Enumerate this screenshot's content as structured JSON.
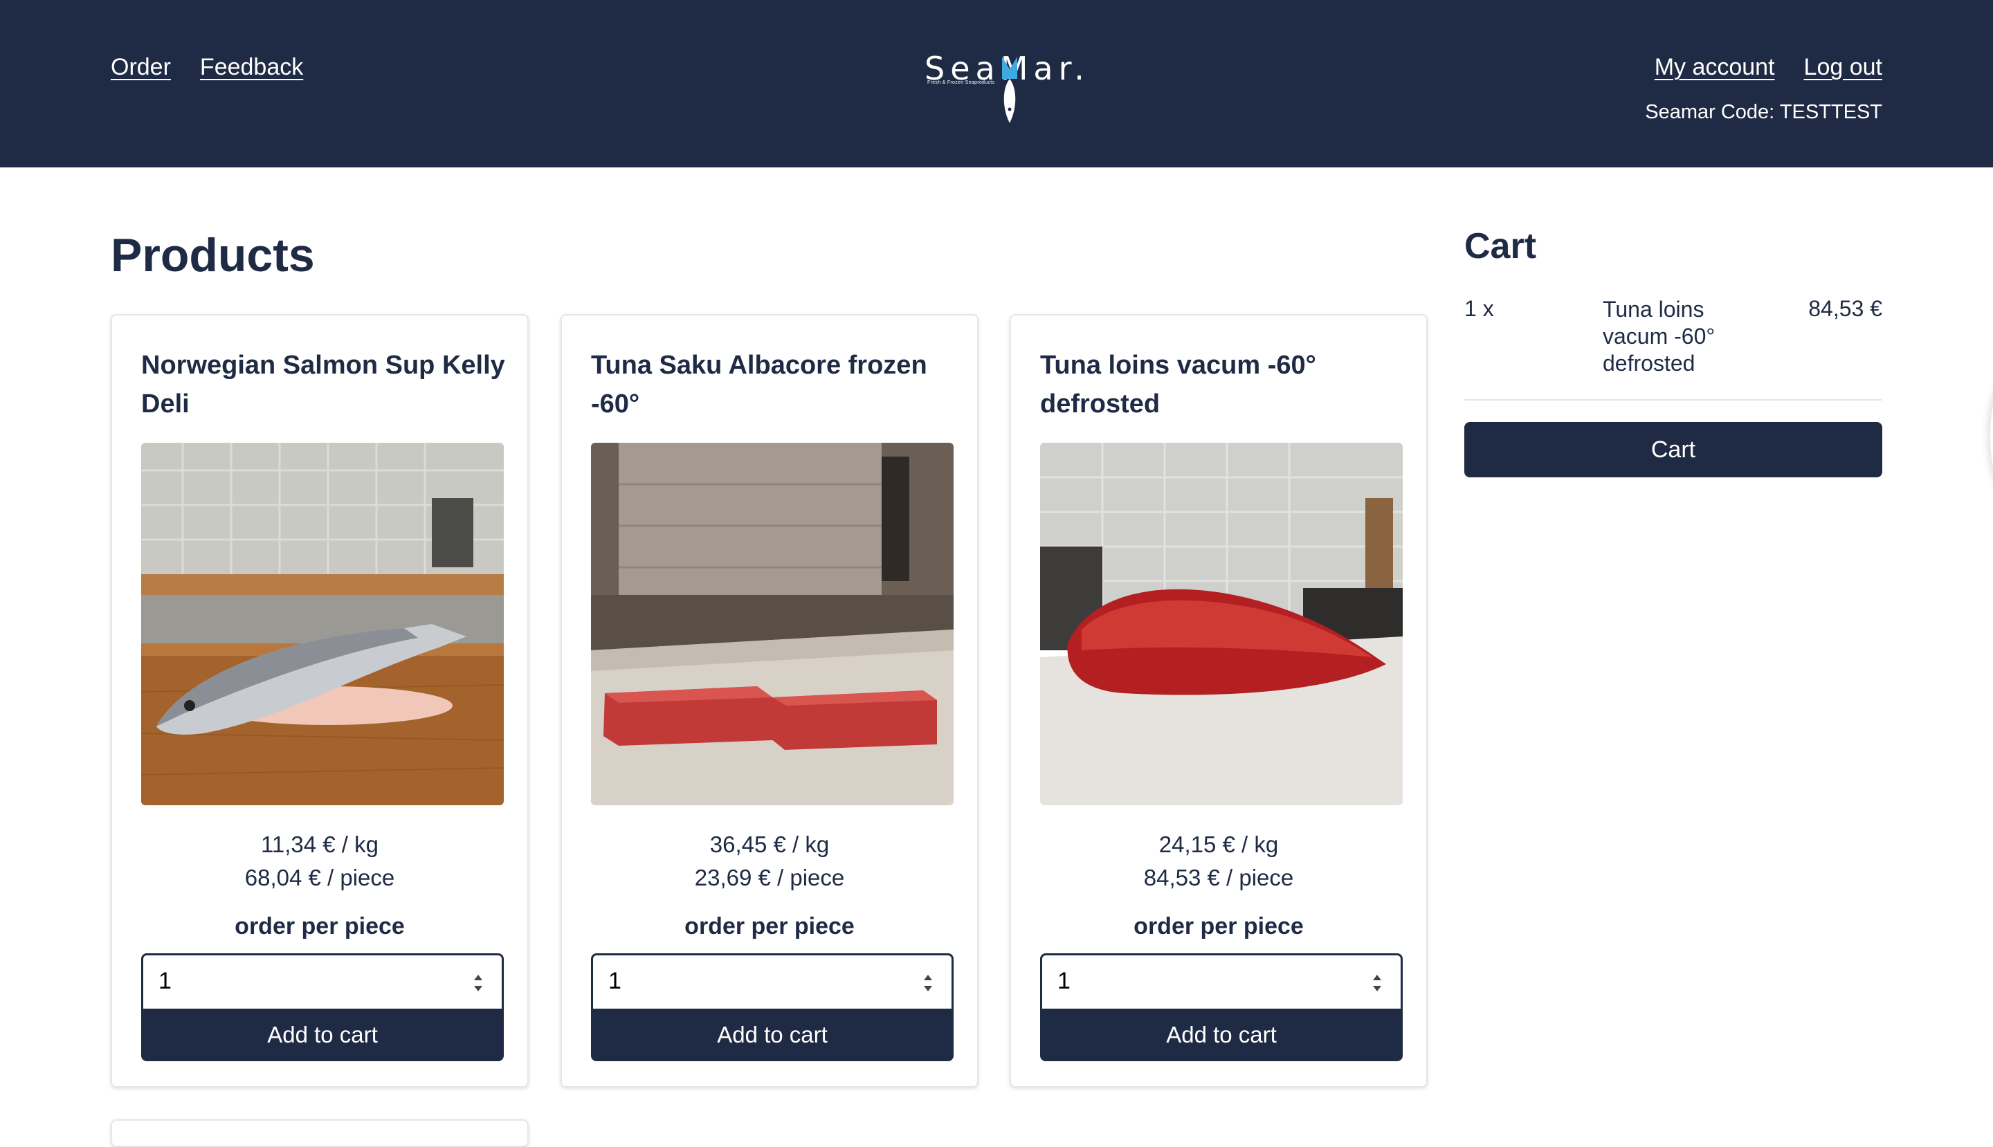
{
  "header": {
    "nav_left": [
      "Order",
      "Feedback"
    ],
    "nav_right": [
      "My account",
      "Log out"
    ],
    "code_line": "Seamar Code: TESTTEST",
    "logo_text": "SeaMar.",
    "logo_sub": "Fresh & Frozen Seaproducts",
    "background": "#1f2a44"
  },
  "main": {
    "title": "Products",
    "products": [
      {
        "name": "Norwegian Salmon Sup Kelly Deli",
        "image": "salmon-on-wooden-board",
        "price_kg": "11,34 € / kg",
        "price_piece": "68,04 € / piece",
        "order_label": "order per piece",
        "quantity": "1",
        "button_label": "Add to cart"
      },
      {
        "name": "Tuna Saku Albacore frozen -60°",
        "image": "two-tuna-saku-blocks",
        "price_kg": "36,45 € / kg",
        "price_piece": "23,69 € / piece",
        "order_label": "order per piece",
        "quantity": "1",
        "button_label": "Add to cart"
      },
      {
        "name": "Tuna loins vacum -60° defrosted",
        "image": "tuna-loin-on-counter",
        "price_kg": "24,15 € / kg",
        "price_piece": "84,53 € / piece",
        "order_label": "order per piece",
        "quantity": "1",
        "button_label": "Add to cart"
      }
    ]
  },
  "cart": {
    "title": "Cart",
    "items": [
      {
        "qty": "1 x",
        "name": "Tuna loins vacum -60° defrosted",
        "price": "84,53 €"
      }
    ],
    "button_label": "Cart"
  },
  "colors": {
    "primary": "#1f2a44",
    "logo_accent": "#3fa9e0",
    "card_border": "#e4e6ea"
  },
  "icons": [
    "seamar-logo",
    "fish-icon",
    "spinner-arrows-icon"
  ]
}
